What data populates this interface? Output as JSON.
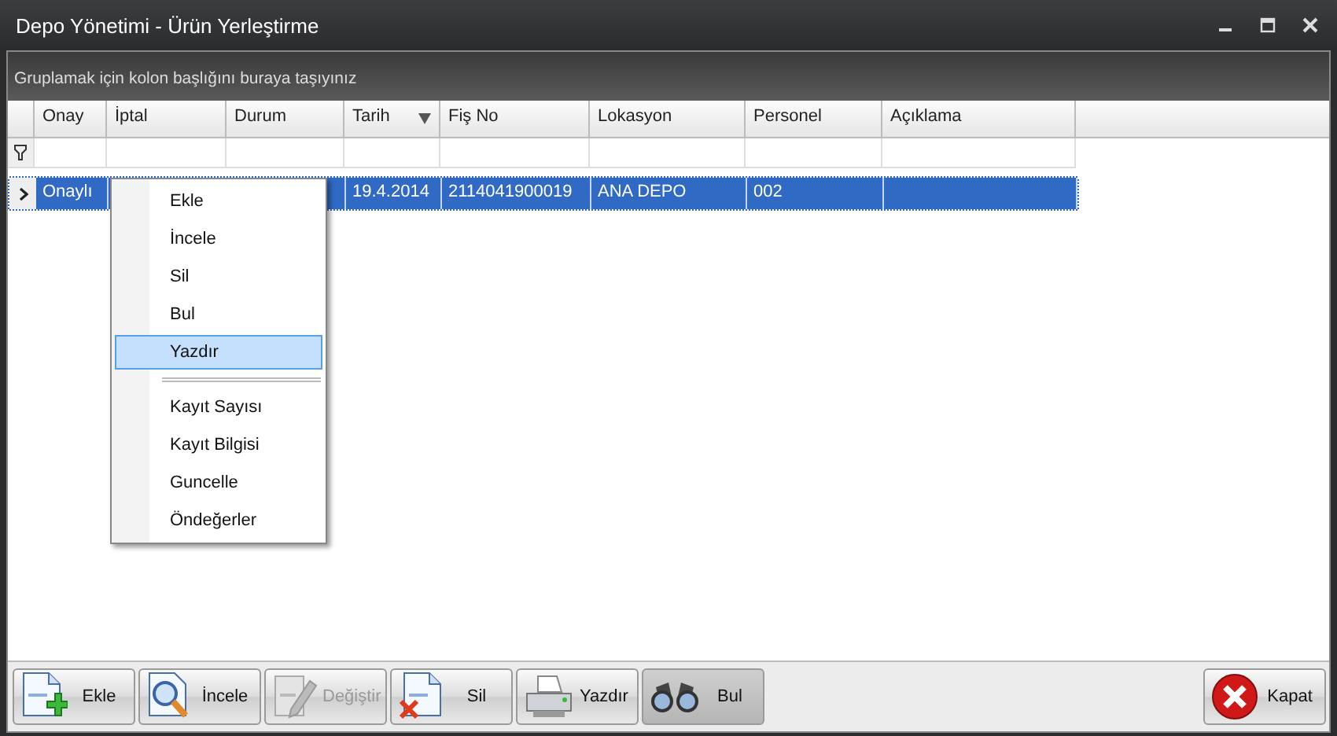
{
  "window": {
    "title": "Depo Yönetimi - Ürün Yerleştirme"
  },
  "group_panel": {
    "hint": "Gruplamak için kolon başlığını buraya taşıyınız"
  },
  "grid": {
    "columns": [
      {
        "label": "Onay",
        "sorted": false
      },
      {
        "label": "İptal",
        "sorted": false
      },
      {
        "label": "Durum",
        "sorted": false
      },
      {
        "label": "Tarih",
        "sorted": true
      },
      {
        "label": "Fiş No",
        "sorted": false
      },
      {
        "label": "Lokasyon",
        "sorted": false
      },
      {
        "label": "Personel",
        "sorted": false
      },
      {
        "label": "Açıklama",
        "sorted": false
      }
    ],
    "rows": [
      {
        "selected": true,
        "cells": [
          "Onaylı",
          null,
          null,
          "19.4.2014",
          "2114041900019",
          "ANA DEPO",
          "002",
          null
        ]
      }
    ]
  },
  "context_menu": {
    "items": [
      {
        "kind": "item",
        "label": "Ekle",
        "selected": false
      },
      {
        "kind": "item",
        "label": "İncele",
        "selected": false
      },
      {
        "kind": "item",
        "label": "Sil",
        "selected": false
      },
      {
        "kind": "item",
        "label": "Bul",
        "selected": false
      },
      {
        "kind": "item",
        "label": "Yazdır",
        "selected": true
      },
      {
        "kind": "separator"
      },
      {
        "kind": "item",
        "label": "Kayıt Sayısı",
        "selected": false
      },
      {
        "kind": "item",
        "label": "Kayıt Bilgisi",
        "selected": false
      },
      {
        "kind": "item",
        "label": "Guncelle",
        "selected": false
      },
      {
        "kind": "item",
        "label": "Öndeğerler",
        "selected": false
      }
    ]
  },
  "toolbar": {
    "buttons": [
      {
        "kind": "add",
        "label": "Ekle",
        "disabled": false,
        "pressed": false
      },
      {
        "kind": "inspect",
        "label": "İncele",
        "disabled": false,
        "pressed": false
      },
      {
        "kind": "edit",
        "label": "Değiştir",
        "disabled": true,
        "pressed": false
      },
      {
        "kind": "delete",
        "label": "Sil",
        "disabled": false,
        "pressed": false
      },
      {
        "kind": "print",
        "label": "Yazdır",
        "disabled": false,
        "pressed": false
      },
      {
        "kind": "find",
        "label": "Bul",
        "disabled": false,
        "pressed": true
      }
    ],
    "close_button": {
      "label": "Kapat"
    }
  }
}
